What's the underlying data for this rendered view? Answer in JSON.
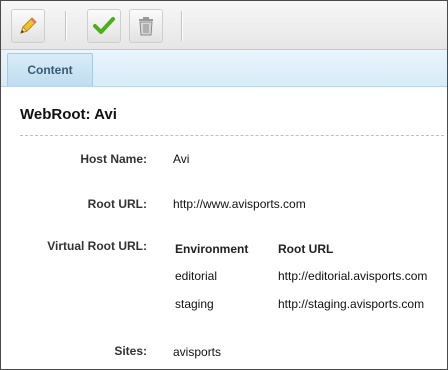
{
  "tabs": [
    {
      "label": "Content"
    }
  ],
  "page": {
    "title": "WebRoot: Avi"
  },
  "fields": {
    "host_name": {
      "label": "Host Name:",
      "value": "Avi"
    },
    "root_url": {
      "label": "Root URL:",
      "value": "http://www.avisports.com"
    },
    "virtual_root_url": {
      "label": "Virtual Root URL:",
      "columns": [
        "Environment",
        "Root URL"
      ],
      "rows": [
        {
          "environment": "editorial",
          "root_url": "http://editorial.avisports.com"
        },
        {
          "environment": "staging",
          "root_url": "http://staging.avisports.com"
        }
      ]
    },
    "sites": {
      "label": "Sites:",
      "value": "avisports"
    }
  },
  "toolbar": {
    "icons": [
      "pencil-icon",
      "checkmark-icon",
      "trash-icon"
    ]
  },
  "colors": {
    "accent": "#bfdcef",
    "tab_text": "#3a5a73",
    "check_green": "#4caf1a"
  }
}
